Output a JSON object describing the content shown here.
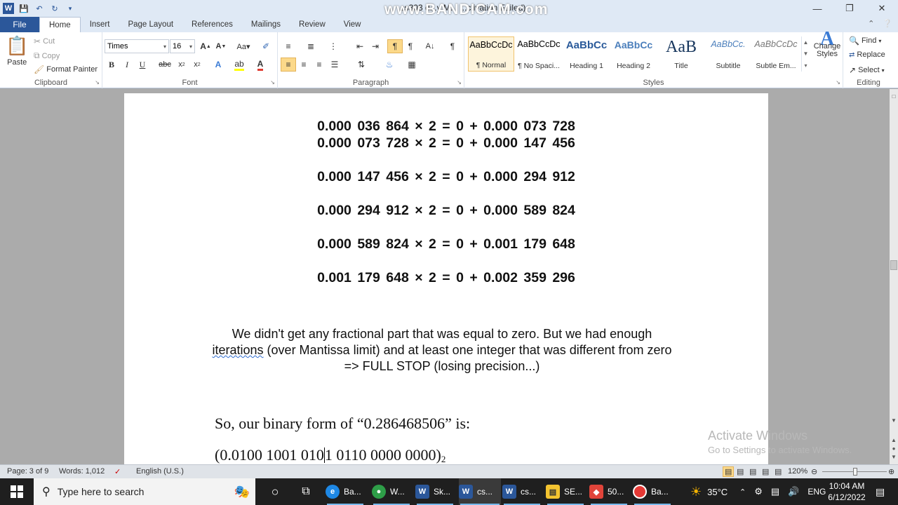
{
  "titlebar": {
    "title": "cs303 demo - Microsoft Word (Product Activation Failed)",
    "title_visible": "cs303 d...y  M...                   ...ctivation Failed)",
    "overlay": "www.BANDICAM.com"
  },
  "tabs": [
    "File",
    "Home",
    "Insert",
    "Page Layout",
    "References",
    "Mailings",
    "Review",
    "View"
  ],
  "ribbon": {
    "clipboard": {
      "paste": "Paste",
      "cut": "Cut",
      "copy": "Copy",
      "format_painter": "Format Painter",
      "label": "Clipboard"
    },
    "font": {
      "name": "Times",
      "size": "16",
      "label": "Font"
    },
    "paragraph": {
      "label": "Paragraph"
    },
    "styles": {
      "items": [
        {
          "sample": "AaBbCcDc",
          "name": "¶ Normal"
        },
        {
          "sample": "AaBbCcDc",
          "name": "¶ No Spaci..."
        },
        {
          "sample": "AaBbCc",
          "name": "Heading 1"
        },
        {
          "sample": "AaBbCc",
          "name": "Heading 2"
        },
        {
          "sample": "AaB",
          "name": "Title"
        },
        {
          "sample": "AaBbCc.",
          "name": "Subtitle"
        },
        {
          "sample": "AaBbCcDc",
          "name": "Subtle Em..."
        }
      ],
      "change_styles": "Change Styles",
      "label": "Styles"
    },
    "editing": {
      "find": "Find",
      "replace": "Replace",
      "select": "Select",
      "label": "Editing"
    }
  },
  "document": {
    "calc_lines": [
      "0.000 036 864 × 2 = 0 + 0.000 073 728",
      "0.000 073 728 × 2 = 0 + 0.000 147 456",
      "0.000 147 456 × 2 = 0 + 0.000 294 912",
      "0.000 294 912 × 2 = 0 + 0.000 589 824",
      "0.000 589 824 × 2 = 0 + 0.001 179 648",
      "0.001 179 648 × 2 = 0 + 0.002 359 296"
    ],
    "para_part1": "We didn't get any fractional part that was equal to zero. But we had enough ",
    "para_squiggle": " iterations",
    "para_part2": " (over Mantissa limit) and at least one integer that was different  from zero => FULL STOP (losing precision...)",
    "conclusion": "So, our binary form of “0.286468506” is:",
    "binary_before_cursor": "(0.0100 1001 010",
    "binary_after_cursor": "1 0110 0000 0000)",
    "binary_base": "2"
  },
  "watermark": {
    "line1": "Activate Windows",
    "line2": "Go to Settings to activate Windows."
  },
  "statusbar": {
    "page": "Page: 3 of 9",
    "words": "Words: 1,012",
    "language": "English (U.S.)",
    "zoom": "120%"
  },
  "taskbar": {
    "search_placeholder": "Type here to search",
    "items": [
      {
        "label": "Ba...",
        "color": "#1e88e5"
      },
      {
        "label": "W...",
        "color": "#2e9e48"
      },
      {
        "label": "Sk...",
        "color": "#2b579a"
      },
      {
        "label": "cs...",
        "color": "#2b579a"
      },
      {
        "label": "cs...",
        "color": "#2b579a"
      },
      {
        "label": "SE...",
        "color": "#f4c430"
      },
      {
        "label": "50...",
        "color": "#e0443a"
      },
      {
        "label": "Ba...",
        "color": "#e53935"
      }
    ],
    "temperature": "35°C",
    "language": "ENG",
    "time": "10:04 AM",
    "date": "6/12/2022"
  }
}
